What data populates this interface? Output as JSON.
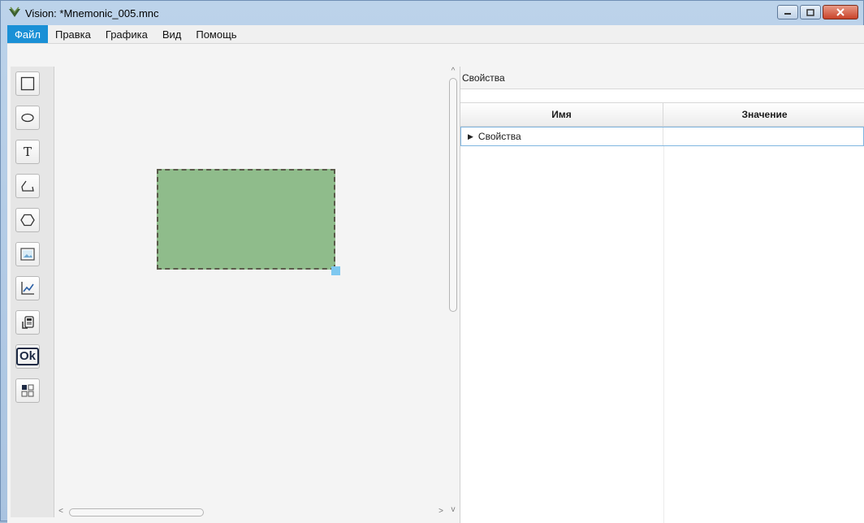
{
  "window": {
    "title": "Vision: *Mnemonic_005.mnc",
    "controls": {
      "minimize_icon": "minimize-icon",
      "maximize_icon": "maximize-icon",
      "close_icon": "close-icon"
    }
  },
  "menu": {
    "items": [
      {
        "label": "Файл",
        "active": true
      },
      {
        "label": "Правка",
        "active": false
      },
      {
        "label": "Графика",
        "active": false
      },
      {
        "label": "Вид",
        "active": false
      },
      {
        "label": "Помощь",
        "active": false
      }
    ],
    "active_color": "#1a90d6"
  },
  "toolbar": {
    "tools": [
      {
        "icon": "rectangle-icon"
      },
      {
        "icon": "ellipse-icon"
      },
      {
        "icon": "text-icon",
        "glyph": "T"
      },
      {
        "icon": "polyline-icon"
      },
      {
        "icon": "polygon-icon"
      },
      {
        "icon": "image-icon"
      },
      {
        "icon": "chart-icon"
      },
      {
        "icon": "print-device-icon"
      },
      {
        "icon": "ok-button-icon",
        "glyph": "Ok"
      },
      {
        "icon": "grid-widget-icon"
      }
    ]
  },
  "canvas": {
    "shape": {
      "type": "rectangle",
      "fill": "#8fbc8b",
      "selected": true
    },
    "selection_handle_color": "#7ec8f0"
  },
  "properties": {
    "panel_title": "Свойства",
    "columns": {
      "name": "Имя",
      "value": "Значение"
    },
    "rows": [
      {
        "name": "Свойства",
        "value": "",
        "expandable": true
      }
    ]
  }
}
